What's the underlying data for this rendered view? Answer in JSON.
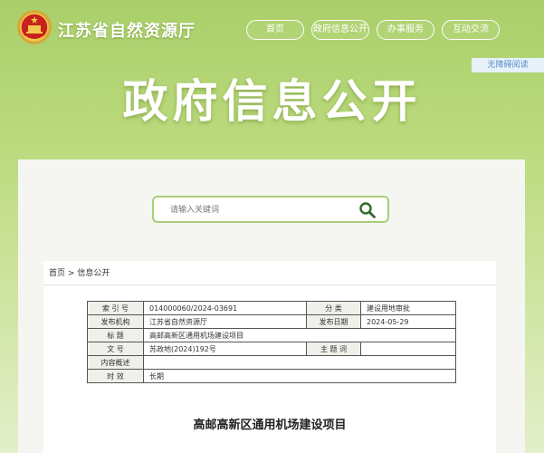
{
  "header": {
    "site_title": "江苏省自然资源厅",
    "nav": [
      "首页",
      "政府信息公开",
      "办事服务",
      "互动交流"
    ],
    "accessibility": "无障碍阅读",
    "hero_title": "政府信息公开"
  },
  "search": {
    "placeholder": "请输入关键词"
  },
  "breadcrumb": {
    "home": "首页",
    "sep": ">",
    "current": "信息公开"
  },
  "meta_table": {
    "index_label": "索 引 号",
    "index_value": "014000060/2024-03691",
    "category_label": "分 类",
    "category_value": "建设用地审批",
    "publisher_label": "发布机构",
    "publisher_value": "江苏省自然资源厅",
    "date_label": "发布日期",
    "date_value": "2024-05-29",
    "title_label": "标 题",
    "title_value": "高邮高新区通用机场建设项目",
    "docno_label": "文 号",
    "docno_value": "苏政地(2024)192号",
    "keywords_label": "主 题 词",
    "keywords_value": "",
    "summary_label": "内容概述",
    "summary_value": "",
    "validity_label": "时 效",
    "validity_value": "长期"
  },
  "doc_title": "高邮高新区通用机场建设项目",
  "colors": {
    "bg_green": "#b3d574",
    "search_border": "#a8cf78",
    "search_icon": "#2f6b2a",
    "table_label_bg": "#eef1ea"
  }
}
